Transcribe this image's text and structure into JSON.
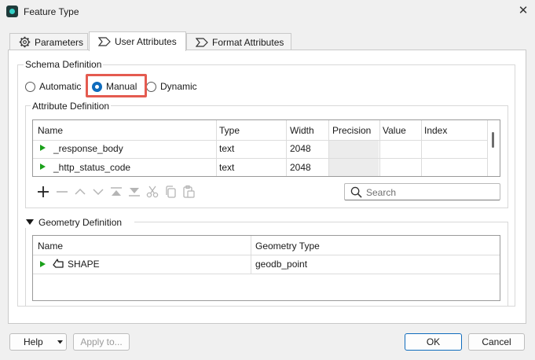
{
  "window": {
    "title": "Feature Type",
    "close_glyph": "✕",
    "app_icon": "fme-feature-type-icon"
  },
  "tabs": [
    {
      "label": "Parameters",
      "icon": "gear-icon",
      "active": false
    },
    {
      "label": "User Attributes",
      "icon": "tag-icon",
      "active": true
    },
    {
      "label": "Format Attributes",
      "icon": "tag-icon",
      "active": false
    }
  ],
  "schema": {
    "label": "Schema Definition",
    "options": [
      {
        "label": "Automatic",
        "checked": false
      },
      {
        "label": "Manual",
        "checked": true
      },
      {
        "label": "Dynamic",
        "checked": false
      }
    ],
    "highlight_color": "#e45b50"
  },
  "attributes": {
    "label": "Attribute Definition",
    "columns": [
      "Name",
      "Type",
      "Width",
      "Precision",
      "Value",
      "Index"
    ],
    "rows": [
      {
        "name": "_response_body",
        "type": "text",
        "width": "2048",
        "precision": "",
        "value": "",
        "index": ""
      },
      {
        "name": "_http_status_code",
        "type": "text",
        "width": "2048",
        "precision": "",
        "value": "",
        "index": ""
      }
    ],
    "toolbar": [
      "add-icon",
      "remove-icon",
      "move-up-icon",
      "move-down-icon",
      "move-top-icon",
      "move-bottom-icon",
      "cut-icon",
      "copy-icon",
      "paste-icon"
    ],
    "search_placeholder": "Search"
  },
  "geometry": {
    "label": "Geometry Definition",
    "expanded": true,
    "columns": [
      "Name",
      "Geometry Type"
    ],
    "rows": [
      {
        "name": "SHAPE",
        "geometry_type": "geodb_point"
      }
    ]
  },
  "footer": {
    "help_label": "Help",
    "apply_label": "Apply to...",
    "ok_label": "OK",
    "cancel_label": "Cancel"
  },
  "colors": {
    "accent": "#0f6cbd",
    "row_arrow": "#1aa01a"
  }
}
